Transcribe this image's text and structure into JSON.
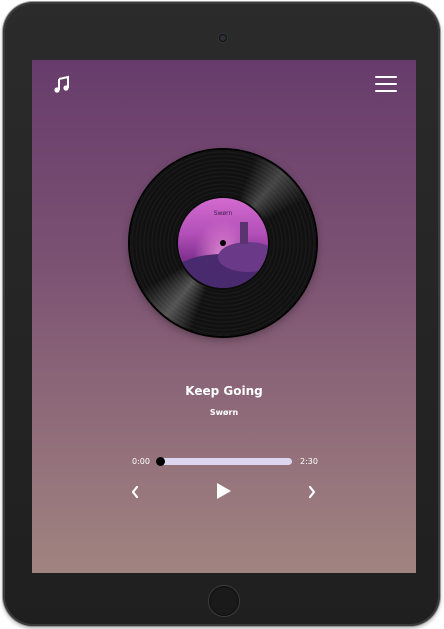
{
  "track": {
    "title": "Keep Going",
    "artist": "Swørn",
    "album_art_text": "Swørn"
  },
  "player": {
    "current_time": "0:00",
    "total_time": "2:30",
    "progress": 0
  },
  "icons": {
    "top_left": "music-note-icon",
    "top_right": "hamburger-menu-icon",
    "previous": "chevron-left-icon",
    "play": "play-icon",
    "next": "chevron-right-icon"
  },
  "colors": {
    "gradient_top": "#673c6c",
    "gradient_bottom": "#a18480",
    "progress_track": "#dcd6ee"
  }
}
